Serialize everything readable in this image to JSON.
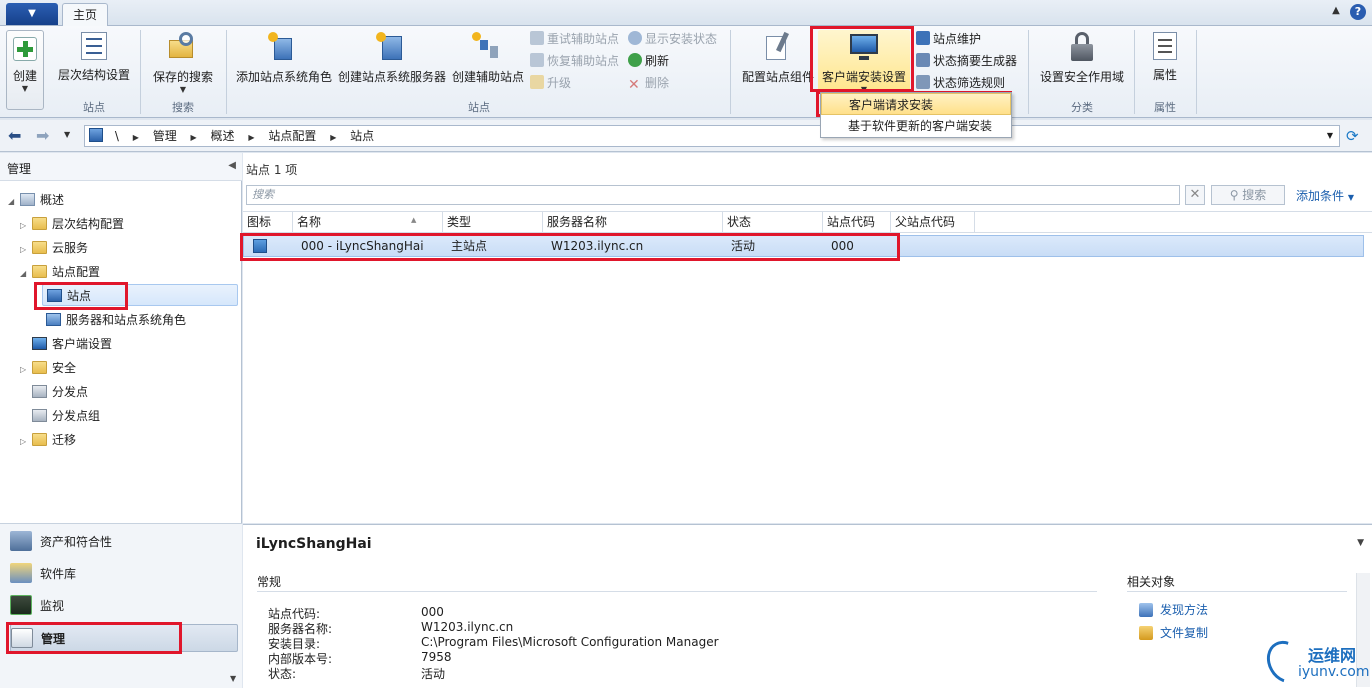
{
  "ribbon": {
    "tab_home": "主页",
    "groups": {
      "site": "站点",
      "search": "搜索",
      "site2": "站点",
      "classify": "分类",
      "properties": "属性"
    },
    "buttons": {
      "create": "创建",
      "hierarchy_settings": "层次结构设置",
      "saved_searches": "保存的搜索",
      "add_site_system_roles": "添加站点系统角色",
      "create_site_system_server": "创建站点系统服务器",
      "create_secondary_site": "创建辅助站点",
      "retry_secondary_site": "重试辅助站点",
      "recover_secondary_site": "恢复辅助站点",
      "upgrade": "升级",
      "show_install_status": "显示安装状态",
      "refresh": "刷新",
      "delete": "删除",
      "configure_site_components": "配置站点组件",
      "client_installation_settings": "客户端安装设置",
      "site_maintenance": "站点维护",
      "status_summarizers": "状态摘要生成器",
      "status_filter_rules": "状态筛选规则",
      "set_security_scopes": "设置安全作用域",
      "properties": "属性"
    },
    "dropdown": {
      "items": [
        "客户端请求安装",
        "基于软件更新的客户端安装"
      ]
    }
  },
  "address": {
    "breadcrumb": [
      "\\",
      "管理",
      "概述",
      "站点配置",
      "站点"
    ]
  },
  "nav": {
    "header": "管理",
    "tree": {
      "overview": "概述",
      "hierarchy_config": "层次结构配置",
      "cloud_services": "云服务",
      "site_config": "站点配置",
      "sites": "站点",
      "servers_roles": "服务器和站点系统角色",
      "client_settings": "客户端设置",
      "security": "安全",
      "distribution_points": "分发点",
      "distribution_point_groups": "分发点组",
      "migration": "迁移"
    },
    "wunderbar": {
      "assets": "资产和符合性",
      "software_library": "软件库",
      "monitoring": "监视",
      "administration": "管理"
    }
  },
  "results": {
    "title": "站点 1 项",
    "search_placeholder": "搜索",
    "search_button": "搜索",
    "add_criteria": "添加条件",
    "columns": [
      "图标",
      "名称",
      "类型",
      "服务器名称",
      "状态",
      "站点代码",
      "父站点代码"
    ],
    "rows": [
      {
        "name": "000 - iLyncShangHai",
        "type": "主站点",
        "server": "W1203.ilync.cn",
        "status": "活动",
        "site_code": "000",
        "parent": ""
      }
    ]
  },
  "details": {
    "title": "iLyncShangHai",
    "general": "常规",
    "fields": [
      {
        "k": "站点代码:",
        "v": "000"
      },
      {
        "k": "服务器名称:",
        "v": "W1203.ilync.cn"
      },
      {
        "k": "安装目录:",
        "v": "C:\\Program Files\\Microsoft Configuration Manager"
      },
      {
        "k": "内部版本号:",
        "v": "7958"
      },
      {
        "k": "状态:",
        "v": "活动"
      }
    ],
    "related_title": "相关对象",
    "related": [
      "发现方法",
      "文件复制"
    ]
  },
  "watermark": {
    "cn": "运维网",
    "en": "iyunv.com"
  },
  "colors": {
    "accent": "#1b5fae",
    "highlight": "#e0162b",
    "selected_row": "#c9ddf6"
  }
}
